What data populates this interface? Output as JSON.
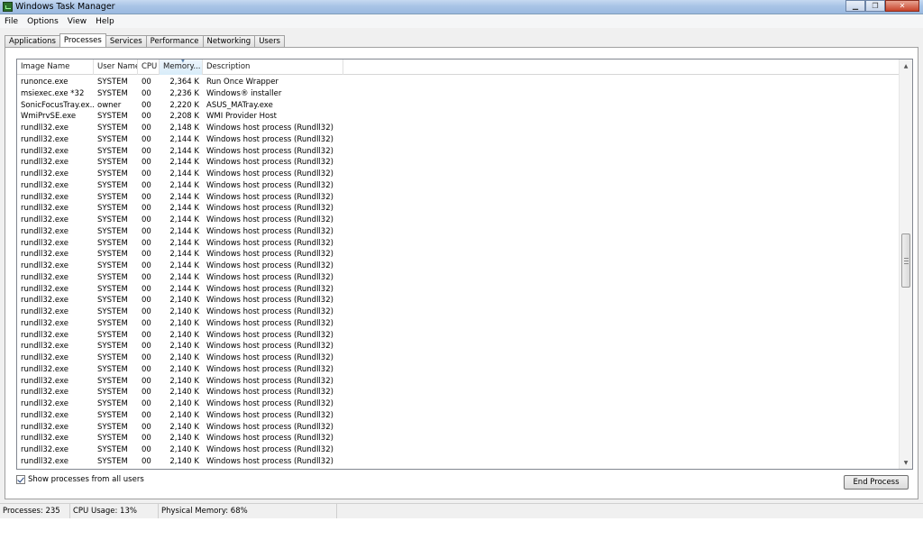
{
  "window": {
    "title": "Windows Task Manager"
  },
  "menu": [
    "File",
    "Options",
    "View",
    "Help"
  ],
  "tabs": [
    "Applications",
    "Processes",
    "Services",
    "Performance",
    "Networking",
    "Users"
  ],
  "active_tab": "Processes",
  "columns": [
    "Image Name",
    "User Name",
    "CPU",
    "Memory...",
    "Description"
  ],
  "rows": [
    [
      "runonce.exe",
      "SYSTEM",
      "00",
      "2,364 K",
      "Run Once Wrapper"
    ],
    [
      "msiexec.exe *32",
      "SYSTEM",
      "00",
      "2,236 K",
      "Windows® installer"
    ],
    [
      "SonicFocusTray.ex...",
      "owner",
      "00",
      "2,220 K",
      "ASUS_MATray.exe"
    ],
    [
      "WmiPrvSE.exe",
      "SYSTEM",
      "00",
      "2,208 K",
      "WMI Provider Host"
    ],
    [
      "rundll32.exe",
      "SYSTEM",
      "00",
      "2,148 K",
      "Windows host process (Rundll32)"
    ],
    [
      "rundll32.exe",
      "SYSTEM",
      "00",
      "2,144 K",
      "Windows host process (Rundll32)"
    ],
    [
      "rundll32.exe",
      "SYSTEM",
      "00",
      "2,144 K",
      "Windows host process (Rundll32)"
    ],
    [
      "rundll32.exe",
      "SYSTEM",
      "00",
      "2,144 K",
      "Windows host process (Rundll32)"
    ],
    [
      "rundll32.exe",
      "SYSTEM",
      "00",
      "2,144 K",
      "Windows host process (Rundll32)"
    ],
    [
      "rundll32.exe",
      "SYSTEM",
      "00",
      "2,144 K",
      "Windows host process (Rundll32)"
    ],
    [
      "rundll32.exe",
      "SYSTEM",
      "00",
      "2,144 K",
      "Windows host process (Rundll32)"
    ],
    [
      "rundll32.exe",
      "SYSTEM",
      "00",
      "2,144 K",
      "Windows host process (Rundll32)"
    ],
    [
      "rundll32.exe",
      "SYSTEM",
      "00",
      "2,144 K",
      "Windows host process (Rundll32)"
    ],
    [
      "rundll32.exe",
      "SYSTEM",
      "00",
      "2,144 K",
      "Windows host process (Rundll32)"
    ],
    [
      "rundll32.exe",
      "SYSTEM",
      "00",
      "2,144 K",
      "Windows host process (Rundll32)"
    ],
    [
      "rundll32.exe",
      "SYSTEM",
      "00",
      "2,144 K",
      "Windows host process (Rundll32)"
    ],
    [
      "rundll32.exe",
      "SYSTEM",
      "00",
      "2,144 K",
      "Windows host process (Rundll32)"
    ],
    [
      "rundll32.exe",
      "SYSTEM",
      "00",
      "2,144 K",
      "Windows host process (Rundll32)"
    ],
    [
      "rundll32.exe",
      "SYSTEM",
      "00",
      "2,144 K",
      "Windows host process (Rundll32)"
    ],
    [
      "rundll32.exe",
      "SYSTEM",
      "00",
      "2,140 K",
      "Windows host process (Rundll32)"
    ],
    [
      "rundll32.exe",
      "SYSTEM",
      "00",
      "2,140 K",
      "Windows host process (Rundll32)"
    ],
    [
      "rundll32.exe",
      "SYSTEM",
      "00",
      "2,140 K",
      "Windows host process (Rundll32)"
    ],
    [
      "rundll32.exe",
      "SYSTEM",
      "00",
      "2,140 K",
      "Windows host process (Rundll32)"
    ],
    [
      "rundll32.exe",
      "SYSTEM",
      "00",
      "2,140 K",
      "Windows host process (Rundll32)"
    ],
    [
      "rundll32.exe",
      "SYSTEM",
      "00",
      "2,140 K",
      "Windows host process (Rundll32)"
    ],
    [
      "rundll32.exe",
      "SYSTEM",
      "00",
      "2,140 K",
      "Windows host process (Rundll32)"
    ],
    [
      "rundll32.exe",
      "SYSTEM",
      "00",
      "2,140 K",
      "Windows host process (Rundll32)"
    ],
    [
      "rundll32.exe",
      "SYSTEM",
      "00",
      "2,140 K",
      "Windows host process (Rundll32)"
    ],
    [
      "rundll32.exe",
      "SYSTEM",
      "00",
      "2,140 K",
      "Windows host process (Rundll32)"
    ],
    [
      "rundll32.exe",
      "SYSTEM",
      "00",
      "2,140 K",
      "Windows host process (Rundll32)"
    ],
    [
      "rundll32.exe",
      "SYSTEM",
      "00",
      "2,140 K",
      "Windows host process (Rundll32)"
    ],
    [
      "rundll32.exe",
      "SYSTEM",
      "00",
      "2,140 K",
      "Windows host process (Rundll32)"
    ],
    [
      "rundll32.exe",
      "SYSTEM",
      "00",
      "2,140 K",
      "Windows host process (Rundll32)"
    ],
    [
      "rundll32.exe",
      "SYSTEM",
      "00",
      "2,140 K",
      "Windows host process (Rundll32)"
    ]
  ],
  "show_all": {
    "label": "Show processes from all users",
    "checked": true
  },
  "end_process": "End Process",
  "status": {
    "processes": "Processes: 235",
    "cpu": "CPU Usage: 13%",
    "memory": "Physical Memory: 68%"
  },
  "icons": {
    "app": "task-manager-icon",
    "minimize": "minimize-icon",
    "maximize": "maximize-icon",
    "close": "close-icon"
  }
}
